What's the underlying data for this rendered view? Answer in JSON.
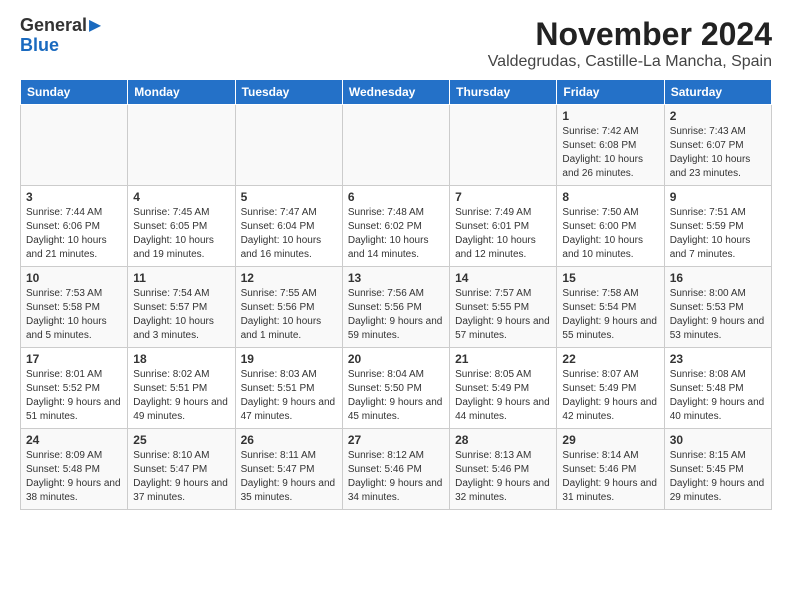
{
  "logo": {
    "general": "General",
    "blue": "Blue"
  },
  "title": "November 2024",
  "location": "Valdegrudas, Castille-La Mancha, Spain",
  "days_of_week": [
    "Sunday",
    "Monday",
    "Tuesday",
    "Wednesday",
    "Thursday",
    "Friday",
    "Saturday"
  ],
  "weeks": [
    [
      {
        "day": "",
        "info": ""
      },
      {
        "day": "",
        "info": ""
      },
      {
        "day": "",
        "info": ""
      },
      {
        "day": "",
        "info": ""
      },
      {
        "day": "",
        "info": ""
      },
      {
        "day": "1",
        "info": "Sunrise: 7:42 AM\nSunset: 6:08 PM\nDaylight: 10 hours and 26 minutes."
      },
      {
        "day": "2",
        "info": "Sunrise: 7:43 AM\nSunset: 6:07 PM\nDaylight: 10 hours and 23 minutes."
      }
    ],
    [
      {
        "day": "3",
        "info": "Sunrise: 7:44 AM\nSunset: 6:06 PM\nDaylight: 10 hours and 21 minutes."
      },
      {
        "day": "4",
        "info": "Sunrise: 7:45 AM\nSunset: 6:05 PM\nDaylight: 10 hours and 19 minutes."
      },
      {
        "day": "5",
        "info": "Sunrise: 7:47 AM\nSunset: 6:04 PM\nDaylight: 10 hours and 16 minutes."
      },
      {
        "day": "6",
        "info": "Sunrise: 7:48 AM\nSunset: 6:02 PM\nDaylight: 10 hours and 14 minutes."
      },
      {
        "day": "7",
        "info": "Sunrise: 7:49 AM\nSunset: 6:01 PM\nDaylight: 10 hours and 12 minutes."
      },
      {
        "day": "8",
        "info": "Sunrise: 7:50 AM\nSunset: 6:00 PM\nDaylight: 10 hours and 10 minutes."
      },
      {
        "day": "9",
        "info": "Sunrise: 7:51 AM\nSunset: 5:59 PM\nDaylight: 10 hours and 7 minutes."
      }
    ],
    [
      {
        "day": "10",
        "info": "Sunrise: 7:53 AM\nSunset: 5:58 PM\nDaylight: 10 hours and 5 minutes."
      },
      {
        "day": "11",
        "info": "Sunrise: 7:54 AM\nSunset: 5:57 PM\nDaylight: 10 hours and 3 minutes."
      },
      {
        "day": "12",
        "info": "Sunrise: 7:55 AM\nSunset: 5:56 PM\nDaylight: 10 hours and 1 minute."
      },
      {
        "day": "13",
        "info": "Sunrise: 7:56 AM\nSunset: 5:56 PM\nDaylight: 9 hours and 59 minutes."
      },
      {
        "day": "14",
        "info": "Sunrise: 7:57 AM\nSunset: 5:55 PM\nDaylight: 9 hours and 57 minutes."
      },
      {
        "day": "15",
        "info": "Sunrise: 7:58 AM\nSunset: 5:54 PM\nDaylight: 9 hours and 55 minutes."
      },
      {
        "day": "16",
        "info": "Sunrise: 8:00 AM\nSunset: 5:53 PM\nDaylight: 9 hours and 53 minutes."
      }
    ],
    [
      {
        "day": "17",
        "info": "Sunrise: 8:01 AM\nSunset: 5:52 PM\nDaylight: 9 hours and 51 minutes."
      },
      {
        "day": "18",
        "info": "Sunrise: 8:02 AM\nSunset: 5:51 PM\nDaylight: 9 hours and 49 minutes."
      },
      {
        "day": "19",
        "info": "Sunrise: 8:03 AM\nSunset: 5:51 PM\nDaylight: 9 hours and 47 minutes."
      },
      {
        "day": "20",
        "info": "Sunrise: 8:04 AM\nSunset: 5:50 PM\nDaylight: 9 hours and 45 minutes."
      },
      {
        "day": "21",
        "info": "Sunrise: 8:05 AM\nSunset: 5:49 PM\nDaylight: 9 hours and 44 minutes."
      },
      {
        "day": "22",
        "info": "Sunrise: 8:07 AM\nSunset: 5:49 PM\nDaylight: 9 hours and 42 minutes."
      },
      {
        "day": "23",
        "info": "Sunrise: 8:08 AM\nSunset: 5:48 PM\nDaylight: 9 hours and 40 minutes."
      }
    ],
    [
      {
        "day": "24",
        "info": "Sunrise: 8:09 AM\nSunset: 5:48 PM\nDaylight: 9 hours and 38 minutes."
      },
      {
        "day": "25",
        "info": "Sunrise: 8:10 AM\nSunset: 5:47 PM\nDaylight: 9 hours and 37 minutes."
      },
      {
        "day": "26",
        "info": "Sunrise: 8:11 AM\nSunset: 5:47 PM\nDaylight: 9 hours and 35 minutes."
      },
      {
        "day": "27",
        "info": "Sunrise: 8:12 AM\nSunset: 5:46 PM\nDaylight: 9 hours and 34 minutes."
      },
      {
        "day": "28",
        "info": "Sunrise: 8:13 AM\nSunset: 5:46 PM\nDaylight: 9 hours and 32 minutes."
      },
      {
        "day": "29",
        "info": "Sunrise: 8:14 AM\nSunset: 5:46 PM\nDaylight: 9 hours and 31 minutes."
      },
      {
        "day": "30",
        "info": "Sunrise: 8:15 AM\nSunset: 5:45 PM\nDaylight: 9 hours and 29 minutes."
      }
    ]
  ]
}
